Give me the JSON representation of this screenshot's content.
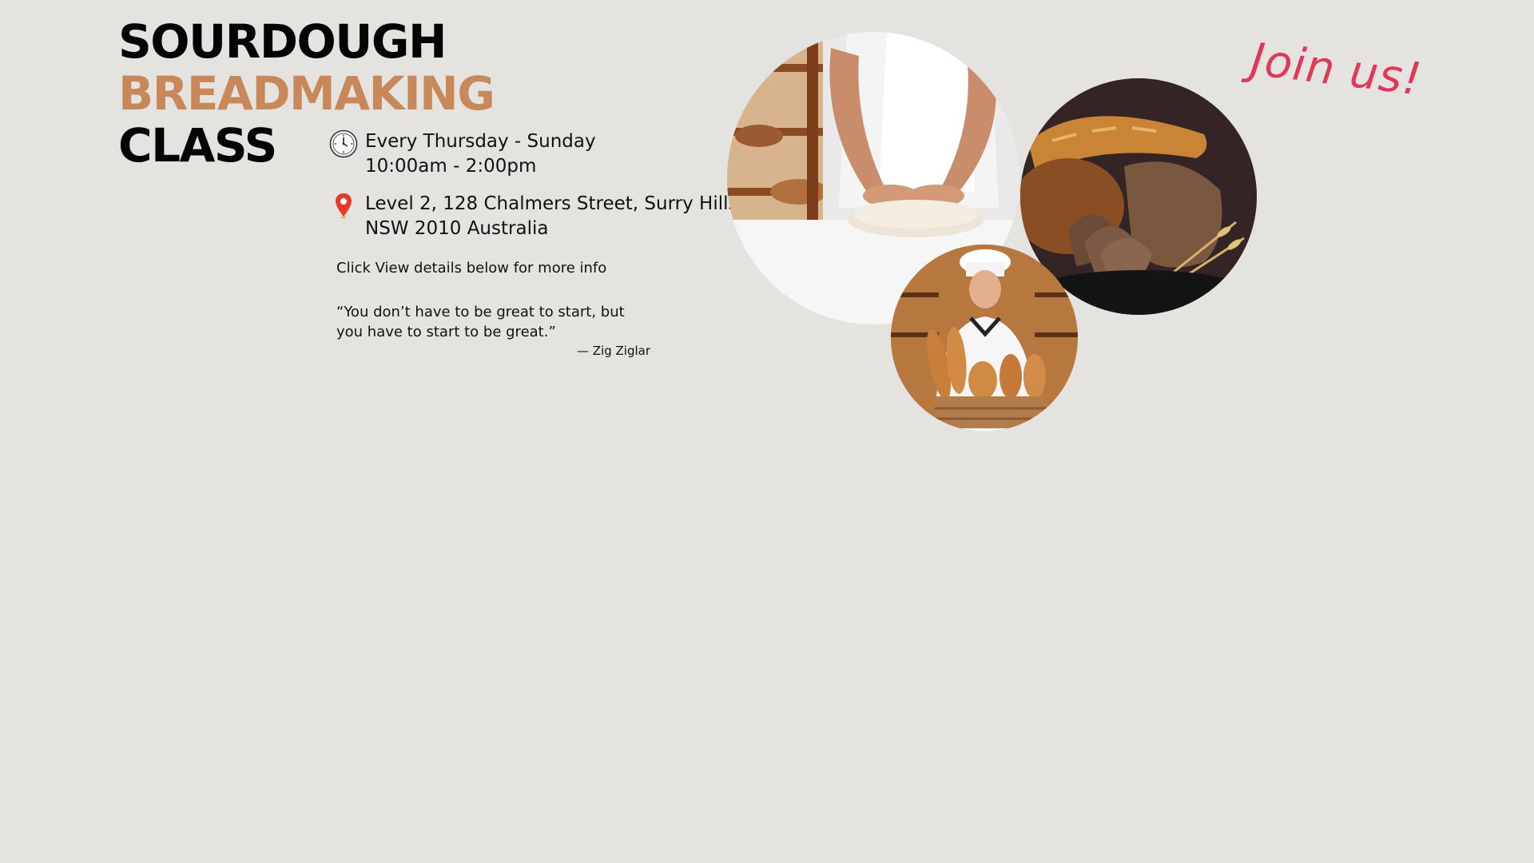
{
  "title": {
    "line1": "SOURDOUGH",
    "line2": "BREADMAKING",
    "line3": "CLASS"
  },
  "schedule": {
    "icon": "clock-icon",
    "days": "Every Thursday - Sunday",
    "hours": "10:00am - 2:00pm"
  },
  "location": {
    "icon": "map-pin-icon",
    "line1": "Level 2, 128 Chalmers Street, Surry Hills",
    "line2": "NSW 2010 Australia"
  },
  "details_hint": "Click View details below for more info",
  "quote": {
    "line1": "“You don’t have to be great to start, but",
    "line2": "you have to start to be great.”",
    "author": "— Zig Ziglar"
  },
  "cta": {
    "join_text": "Join us!"
  },
  "colors": {
    "background": "#e4e3df",
    "accent": "#c8885a",
    "join": "#e0385a",
    "pin": "#e53a2a"
  }
}
